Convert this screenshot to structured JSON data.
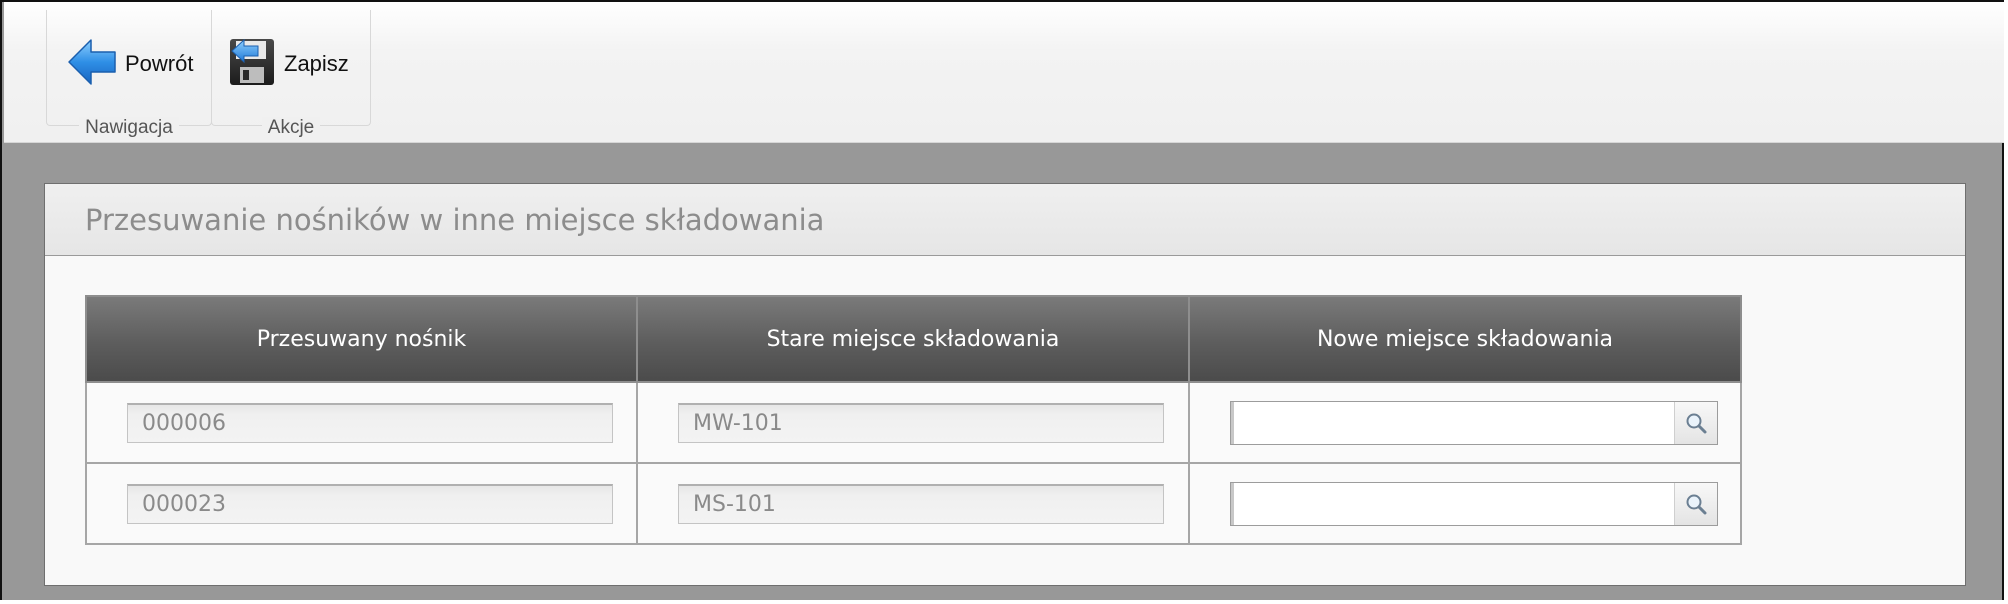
{
  "toolbar": {
    "groups": [
      {
        "label": "Nawigacja",
        "button": {
          "label": "Powrót",
          "icon": "back-arrow-icon"
        }
      },
      {
        "label": "Akcje",
        "button": {
          "label": "Zapisz",
          "icon": "save-floppy-icon"
        }
      }
    ]
  },
  "panel": {
    "title": "Przesuwanie nośników w inne miejsce składowania",
    "columns": [
      "Przesuwany nośnik",
      "Stare miejsce składowania",
      "Nowe miejsce składowania"
    ],
    "rows": [
      {
        "carrier": "000006",
        "old_location": "MW-101",
        "new_location": ""
      },
      {
        "carrier": "000023",
        "old_location": "MS-101",
        "new_location": ""
      }
    ]
  },
  "colors": {
    "header_gradient_top": "#7a7a7a",
    "header_gradient_bottom": "#4b4b4b",
    "backdrop": "#989898",
    "back_arrow": "#2f8fe6"
  }
}
